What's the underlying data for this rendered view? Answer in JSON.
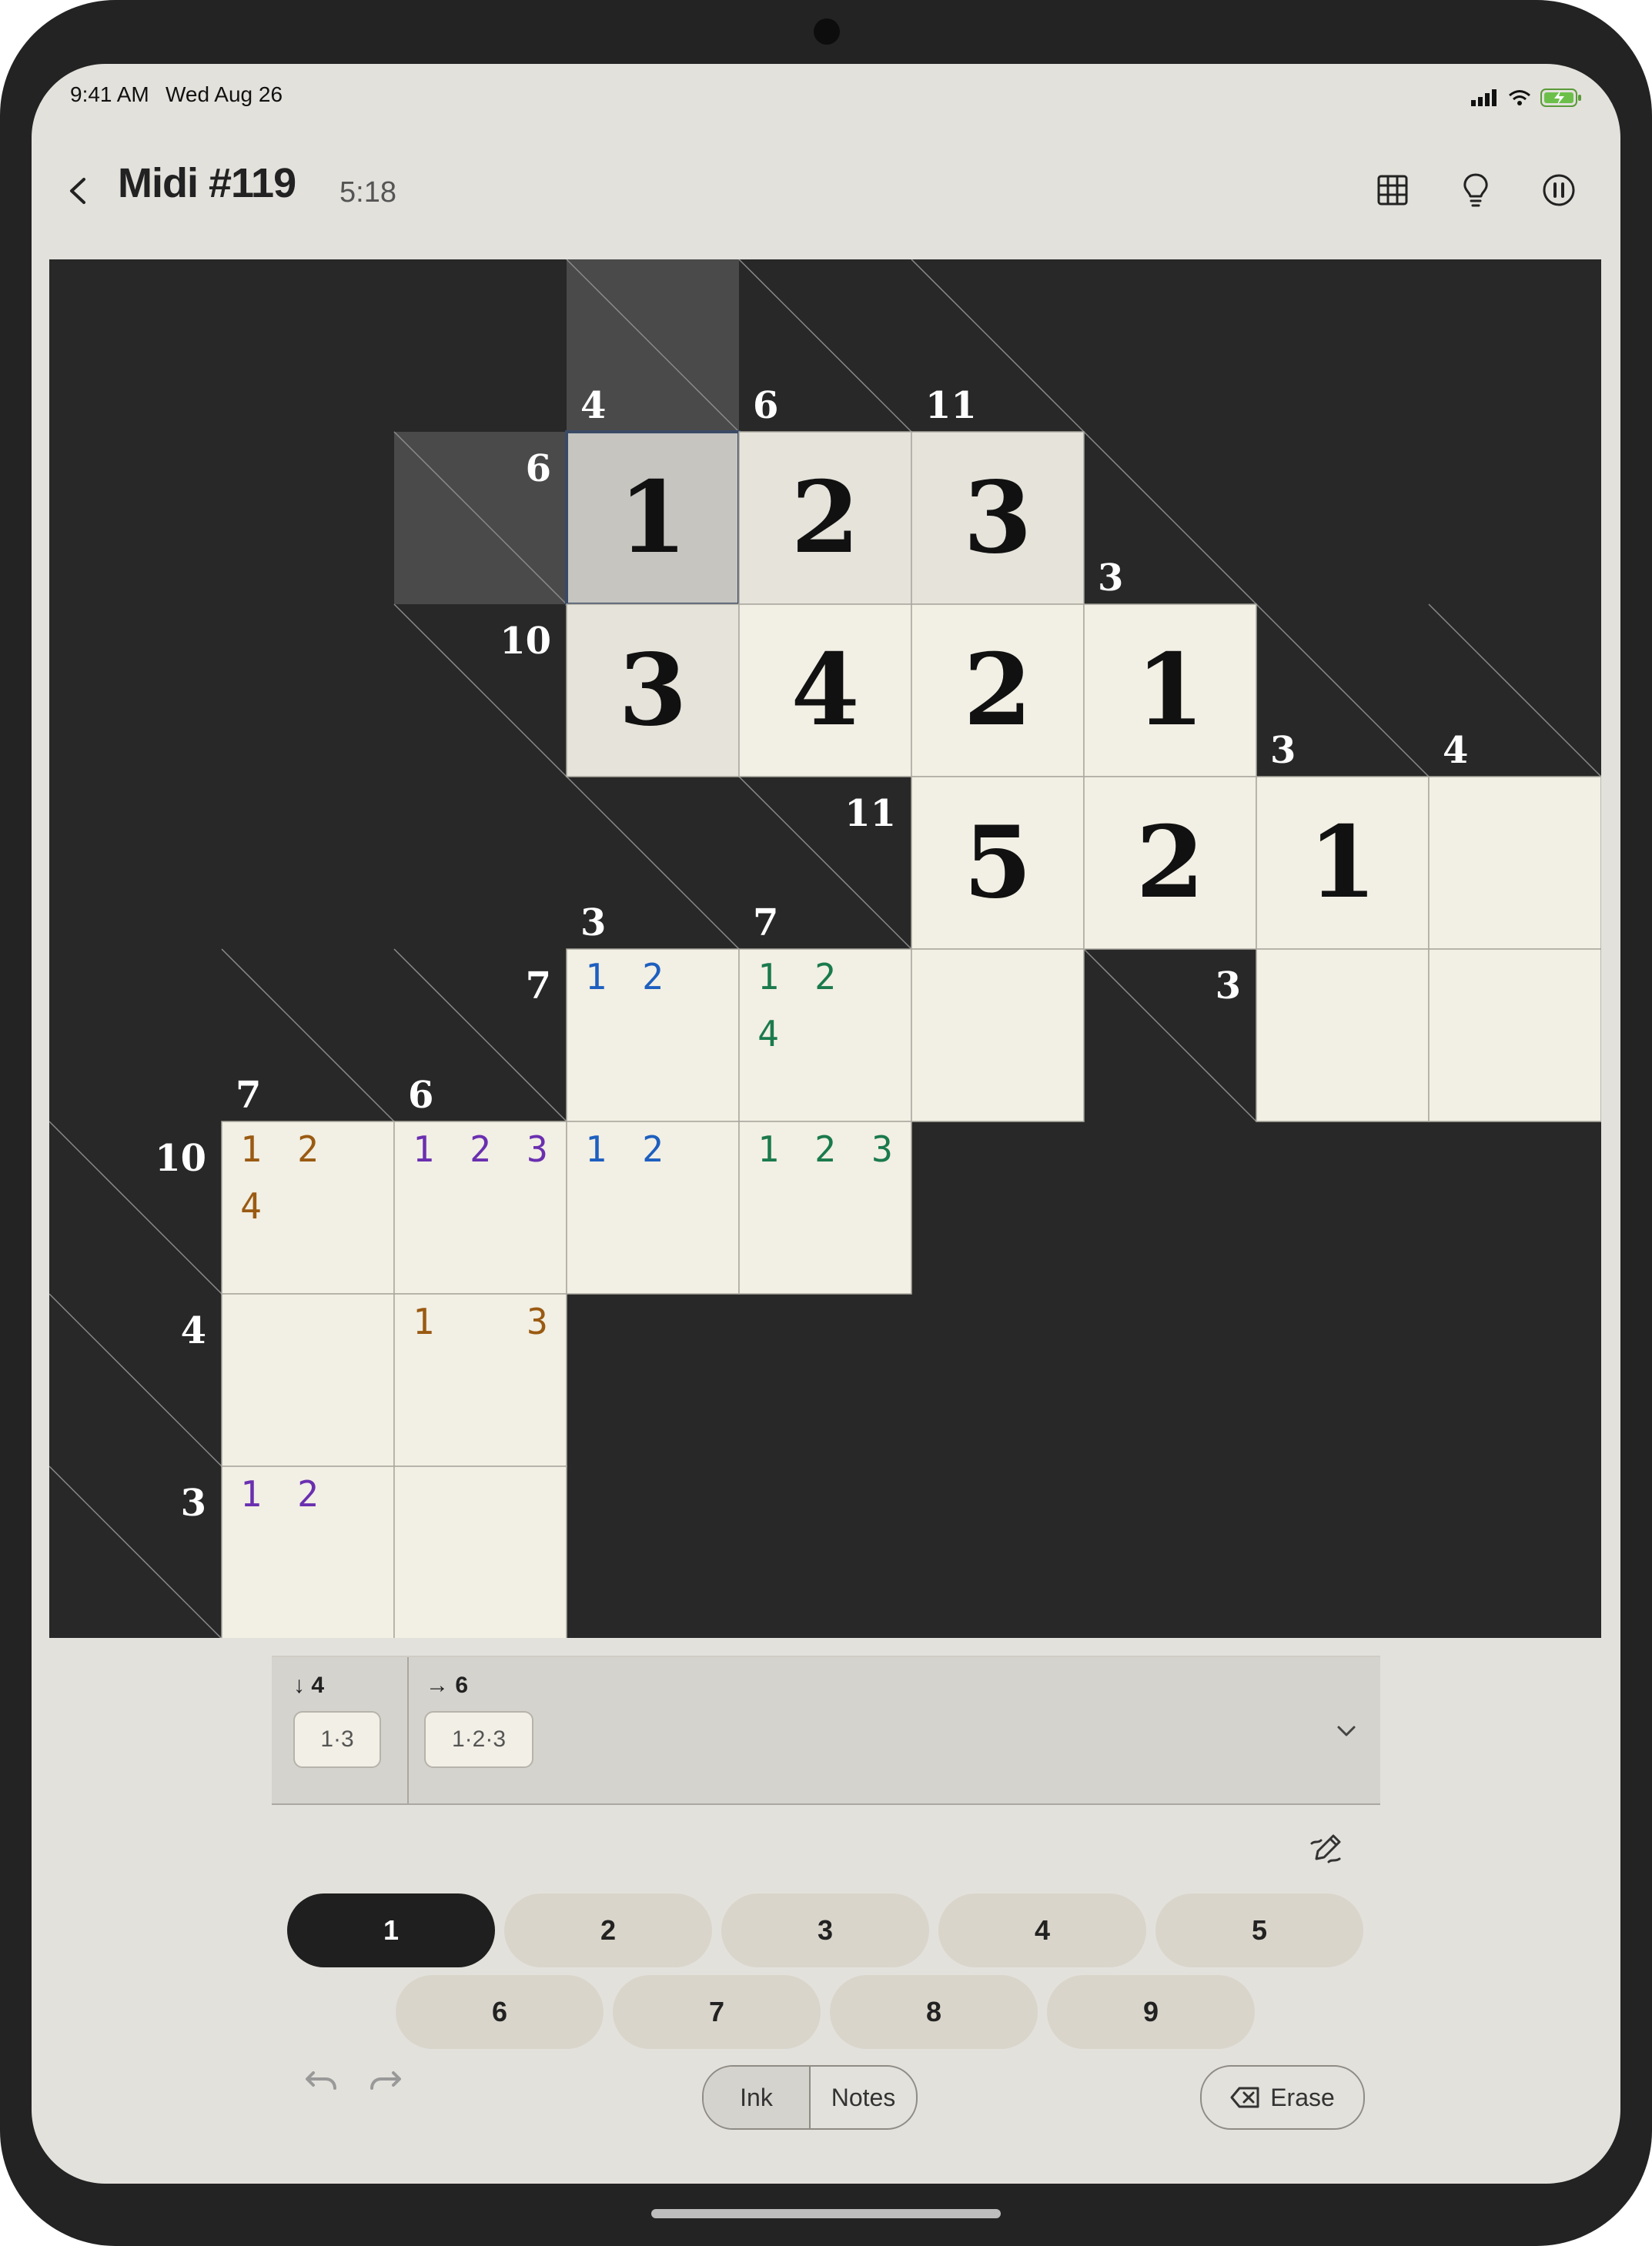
{
  "status": {
    "time": "9:41 AM",
    "date": "Wed Aug 26"
  },
  "nav": {
    "title": "Midi #119",
    "timer": "5:18",
    "icons": [
      "chevron-left-icon",
      "grid-icon",
      "lightbulb-icon",
      "pause-icon"
    ]
  },
  "board": {
    "clues": [
      {
        "r": 0,
        "c": 3,
        "down": "4"
      },
      {
        "r": 0,
        "c": 4,
        "down": "6"
      },
      {
        "r": 0,
        "c": 5,
        "down": "11"
      },
      {
        "r": 1,
        "c": 2,
        "across": "6"
      },
      {
        "r": 1,
        "c": 6,
        "down": "3"
      },
      {
        "r": 2,
        "c": 2,
        "across": "10"
      },
      {
        "r": 2,
        "c": 7,
        "down": "3"
      },
      {
        "r": 2,
        "c": 8,
        "down": "4"
      },
      {
        "r": 3,
        "c": 3,
        "down": "3"
      },
      {
        "r": 3,
        "c": 4,
        "down": "7",
        "across": "11"
      },
      {
        "r": 4,
        "c": 1,
        "down": "7"
      },
      {
        "r": 4,
        "c": 2,
        "down": "6",
        "across": "7"
      },
      {
        "r": 4,
        "c": 6,
        "across": "3"
      },
      {
        "r": 5,
        "c": 0,
        "across": "10"
      },
      {
        "r": 6,
        "c": 0,
        "across": "4"
      },
      {
        "r": 7,
        "c": 0,
        "across": "3"
      }
    ],
    "cells": [
      {
        "r": 1,
        "c": 3,
        "v": "1",
        "state": "selected"
      },
      {
        "r": 1,
        "c": 4,
        "v": "2",
        "state": "word"
      },
      {
        "r": 1,
        "c": 5,
        "v": "3",
        "state": "word"
      },
      {
        "r": 2,
        "c": 3,
        "v": "3",
        "state": "col"
      },
      {
        "r": 2,
        "c": 4,
        "v": "4"
      },
      {
        "r": 2,
        "c": 5,
        "v": "2"
      },
      {
        "r": 2,
        "c": 6,
        "v": "1"
      },
      {
        "r": 3,
        "c": 5,
        "v": "5"
      },
      {
        "r": 3,
        "c": 6,
        "v": "2"
      },
      {
        "r": 3,
        "c": 7,
        "v": "1"
      },
      {
        "r": 3,
        "c": 8
      },
      {
        "r": 4,
        "c": 3,
        "notes": [
          "1",
          "2"
        ],
        "color": "#1d5fbf"
      },
      {
        "r": 4,
        "c": 4,
        "notes": [
          "1",
          "2",
          "4"
        ],
        "color": "#1a7a4c"
      },
      {
        "r": 4,
        "c": 5
      },
      {
        "r": 4,
        "c": 7
      },
      {
        "r": 4,
        "c": 8
      },
      {
        "r": 5,
        "c": 1,
        "notes": [
          "1",
          "2",
          "4"
        ],
        "color": "#9a5a12"
      },
      {
        "r": 5,
        "c": 2,
        "notes": [
          "1",
          "2",
          "3"
        ],
        "color": "#6a2fb0"
      },
      {
        "r": 5,
        "c": 3,
        "notes": [
          "1",
          "2"
        ],
        "color": "#1d5fbf"
      },
      {
        "r": 5,
        "c": 4,
        "notes": [
          "1",
          "2",
          "3"
        ],
        "color": "#1a7a4c"
      },
      {
        "r": 6,
        "c": 1
      },
      {
        "r": 6,
        "c": 2,
        "notes": [
          "1",
          "3"
        ],
        "color": "#9a5a12"
      },
      {
        "r": 7,
        "c": 1,
        "notes": [
          "1",
          "2"
        ],
        "color": "#6a2fb0"
      },
      {
        "r": 7,
        "c": 2
      }
    ],
    "highlight_clues": [
      {
        "r": 0,
        "c": 3
      },
      {
        "r": 1,
        "c": 2
      }
    ]
  },
  "cluebar": {
    "down_label": "↓ 4",
    "down_combo": "1·3",
    "across_label": "→ 6",
    "across_combo": "1·2·3"
  },
  "numpad": {
    "keys": [
      "1",
      "2",
      "3",
      "4",
      "5",
      "6",
      "7",
      "8",
      "9"
    ],
    "selected": "1"
  },
  "modes": {
    "ink": "Ink",
    "notes": "Notes",
    "active": "Ink"
  },
  "erase": {
    "label": "Erase"
  },
  "colors": {
    "board_bg": "#282828",
    "cell": "#f2efe4",
    "word_cell": "#e5e3da",
    "selected_cell": "#c6c5c0",
    "highlight_clue": "#4a4a4a"
  }
}
